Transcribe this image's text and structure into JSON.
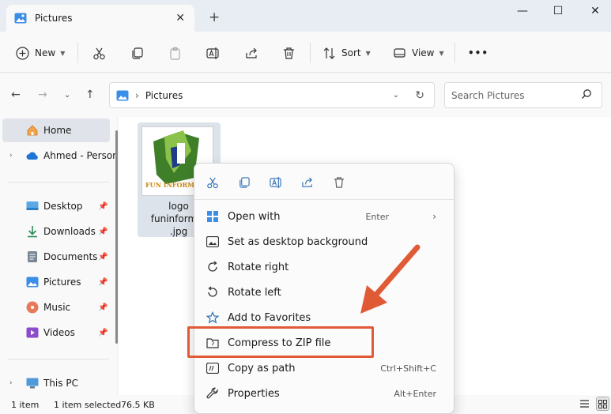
{
  "window": {
    "tab_title": "Pictures",
    "new_tab_symbol": "+",
    "close_tab_symbol": "✕",
    "minimize_symbol": "—",
    "maximize_symbol": "☐",
    "close_symbol": "✕"
  },
  "toolbar": {
    "new_label": "New",
    "sort_label": "Sort",
    "view_label": "View",
    "more_label": "•••"
  },
  "address": {
    "path": "Pictures",
    "search_placeholder": "Search Pictures"
  },
  "sidebar": {
    "home": "Home",
    "onedrive": "Ahmed - Persor",
    "items": [
      {
        "label": "Desktop",
        "icon": "desktop-icon"
      },
      {
        "label": "Downloads",
        "icon": "download-icon"
      },
      {
        "label": "Documents",
        "icon": "documents-icon"
      },
      {
        "label": "Pictures",
        "icon": "pictures-icon"
      },
      {
        "label": "Music",
        "icon": "music-icon"
      },
      {
        "label": "Videos",
        "icon": "videos-icon"
      }
    ],
    "this_pc": "This PC"
  },
  "file": {
    "name_line1": "logo",
    "name_line2": "funinformat",
    "name_line3": ".jpg",
    "thumb_text": "FUN INFORMAT"
  },
  "context_menu": {
    "items": [
      {
        "label": "Open with",
        "shortcut": "Enter",
        "icon": "open-with-icon"
      },
      {
        "label": "Set as desktop background",
        "shortcut": "",
        "icon": "desktop-background-icon"
      },
      {
        "label": "Rotate right",
        "shortcut": "",
        "icon": "rotate-right-icon"
      },
      {
        "label": "Rotate left",
        "shortcut": "",
        "icon": "rotate-left-icon"
      },
      {
        "label": "Add to Favorites",
        "shortcut": "",
        "icon": "star-icon"
      },
      {
        "label": "Compress to ZIP file",
        "shortcut": "",
        "icon": "zip-icon"
      },
      {
        "label": "Copy as path",
        "shortcut": "Ctrl+Shift+C",
        "icon": "copy-path-icon"
      },
      {
        "label": "Properties",
        "shortcut": "Alt+Enter",
        "icon": "wrench-icon"
      }
    ],
    "submenu_arrow": "›"
  },
  "status": {
    "count": "1 item",
    "selected": "1 item selected",
    "size": "76.5 KB"
  },
  "colors": {
    "accent": "#0067c0",
    "highlight": "#e05a36"
  }
}
